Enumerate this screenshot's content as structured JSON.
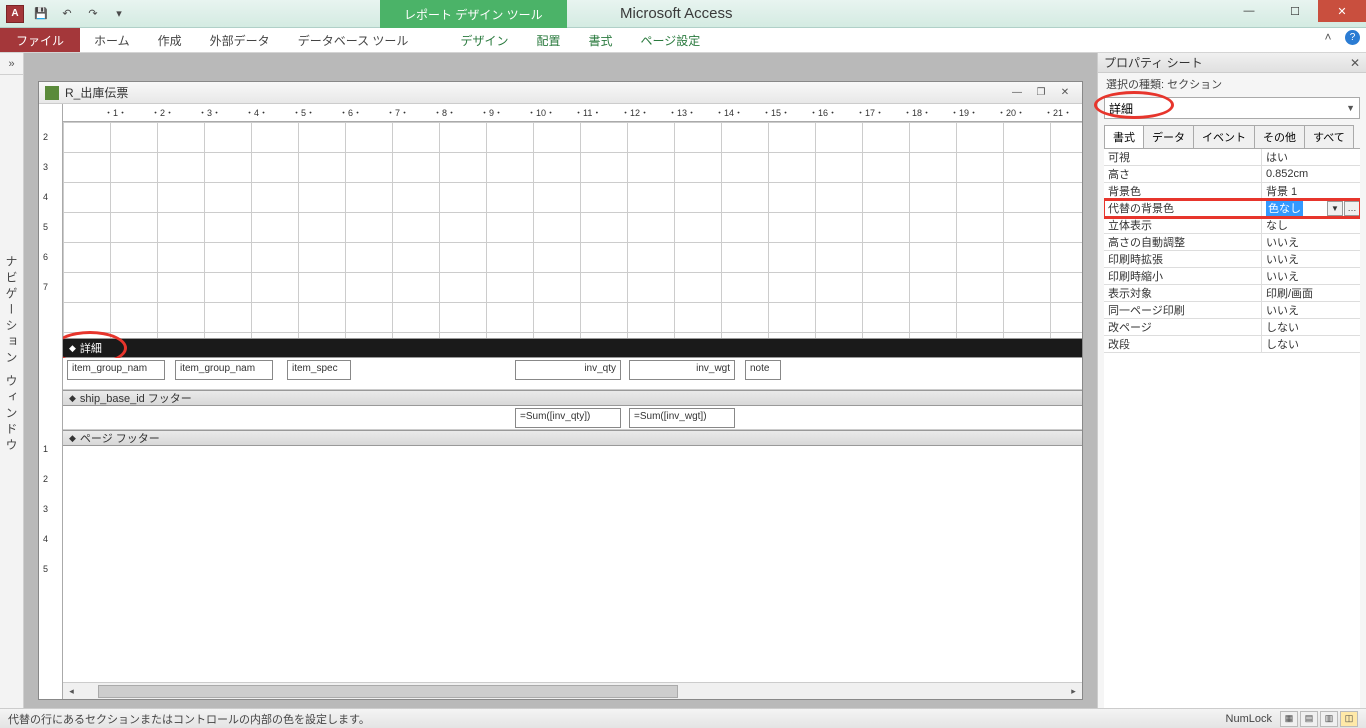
{
  "titlebar": {
    "app_icon_letter": "A",
    "contextual_tab": "レポート デザイン ツール",
    "app_title": "Microsoft Access"
  },
  "ribbon": {
    "file": "ファイル",
    "tabs": [
      "ホーム",
      "作成",
      "外部データ",
      "データベース ツール"
    ],
    "context_tabs": [
      "デザイン",
      "配置",
      "書式",
      "ページ設定"
    ]
  },
  "nav_label": "ナビゲーション ウィンドウ",
  "doc": {
    "title": "R_出庫伝票",
    "sections": {
      "detail": "詳細",
      "footer_group": "ship_base_id フッター",
      "page_footer": "ページ フッター"
    },
    "fields": {
      "f1": "item_group_nam",
      "f2": "item_group_nam",
      "f3": "item_spec",
      "f4": "inv_qty",
      "f5": "inv_wgt",
      "f6": "note",
      "sum1": "=Sum([inv_qty])",
      "sum2": "=Sum([inv_wgt])"
    },
    "ruler_cm_max": 22
  },
  "propsheet": {
    "title": "プロパティ シート",
    "type_label": "選択の種類: セクション",
    "selected_object": "詳細",
    "tabs": [
      "書式",
      "データ",
      "イベント",
      "その他",
      "すべて"
    ],
    "active_tab": 0,
    "rows": [
      {
        "k": "可視",
        "v": "はい"
      },
      {
        "k": "高さ",
        "v": "0.852cm"
      },
      {
        "k": "背景色",
        "v": "背景 1"
      },
      {
        "k": "代替の背景色",
        "v": "色なし",
        "highlighted": true,
        "selected": true,
        "has_dd": true,
        "has_dots": true
      },
      {
        "k": "立体表示",
        "v": "なし"
      },
      {
        "k": "高さの自動調整",
        "v": "いいえ"
      },
      {
        "k": "印刷時拡張",
        "v": "いいえ"
      },
      {
        "k": "印刷時縮小",
        "v": "いいえ"
      },
      {
        "k": "表示対象",
        "v": "印刷/画面"
      },
      {
        "k": "同一ページ印刷",
        "v": "いいえ"
      },
      {
        "k": "改ページ",
        "v": "しない"
      },
      {
        "k": "改段",
        "v": "しない"
      }
    ]
  },
  "statusbar": {
    "message": "代替の行にあるセクションまたはコントロールの内部の色を設定します。",
    "numlock": "NumLock"
  }
}
